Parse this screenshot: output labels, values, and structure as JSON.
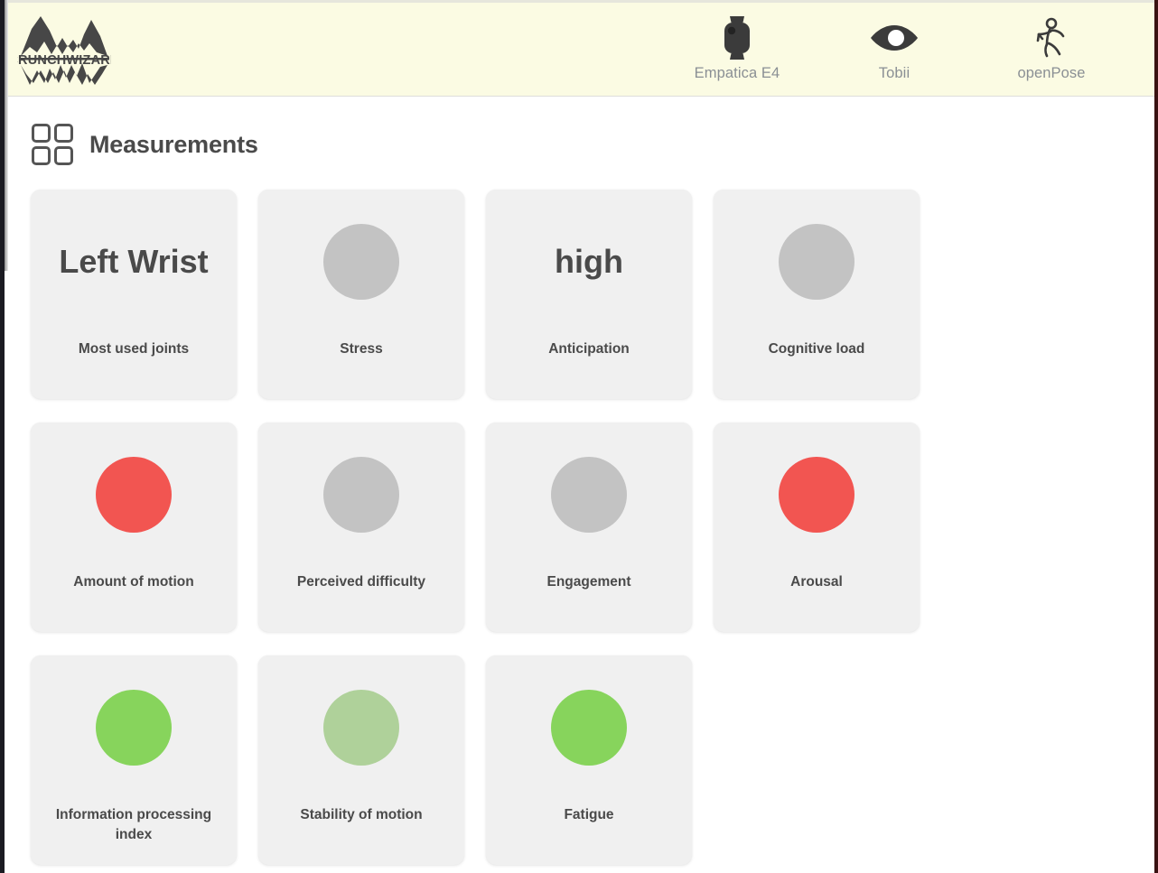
{
  "app": {
    "brand_name": "CRUNCHWIZARD",
    "brand_icon": "mountain-logo",
    "header_bg": "#FBFBE3",
    "card_bg": "#F0F0F0",
    "text_color": "#4A4A4A",
    "muted_text_color": "#8A8F94"
  },
  "header": {
    "devices": [
      {
        "label": "Empatica E4",
        "icon": "smartwatch-icon"
      },
      {
        "label": "Tobii",
        "icon": "eye-icon"
      },
      {
        "label": "openPose",
        "icon": "running-person-icon"
      }
    ]
  },
  "section": {
    "title": "Measurements",
    "icon": "grid-four-squares-icon"
  },
  "status_colors": {
    "gray": "#C3C3C3",
    "red": "#F25551",
    "green": "#87D45C",
    "light_green": "#AFD19A"
  },
  "measurements": [
    {
      "label": "Most used joints",
      "kind": "text",
      "value": "Left Wrist"
    },
    {
      "label": "Stress",
      "kind": "status",
      "color": "#C3C3C3"
    },
    {
      "label": "Anticipation",
      "kind": "text",
      "value": "high"
    },
    {
      "label": "Cognitive load",
      "kind": "status",
      "color": "#C3C3C3"
    },
    {
      "label": "Amount of motion",
      "kind": "status",
      "color": "#F25551"
    },
    {
      "label": "Perceived difficulty",
      "kind": "status",
      "color": "#C3C3C3"
    },
    {
      "label": "Engagement",
      "kind": "status",
      "color": "#C3C3C3"
    },
    {
      "label": "Arousal",
      "kind": "status",
      "color": "#F25551"
    },
    {
      "label": "Information processing index",
      "kind": "status",
      "color": "#87D45C"
    },
    {
      "label": "Stability of motion",
      "kind": "status",
      "color": "#AFD19A"
    },
    {
      "label": "Fatigue",
      "kind": "status",
      "color": "#87D45C"
    }
  ]
}
